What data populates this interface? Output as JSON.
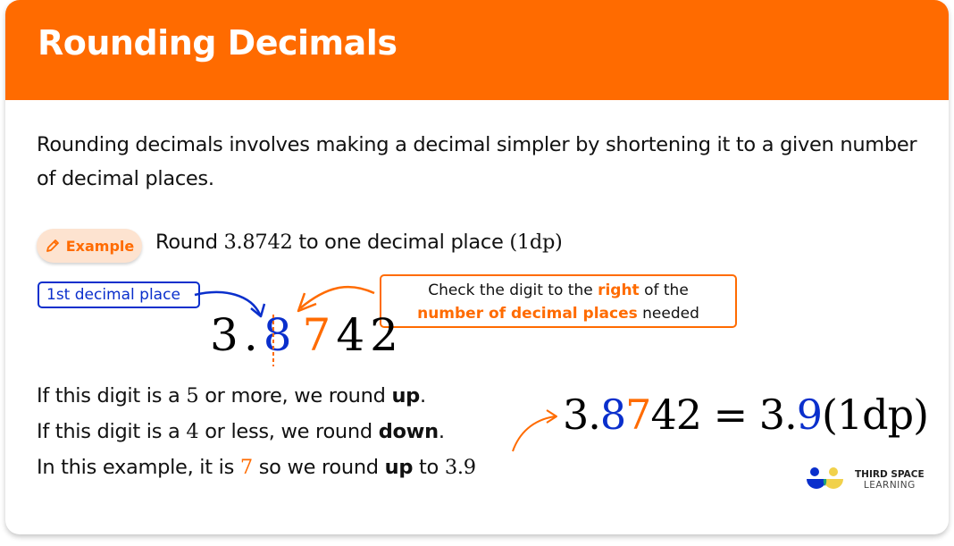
{
  "header": {
    "title": "Rounding Decimals",
    "background_color": "#ff6b00"
  },
  "intro": "Rounding decimals involves making a decimal simpler by shortening it to a given number of decimal places.",
  "example": {
    "badge_label": "Example",
    "badge_icon": "pencil-icon",
    "question_prefix": "Round ",
    "question_number": "3.8742",
    "question_suffix": " to one decimal place ",
    "question_dp": "(1dp)"
  },
  "annotations": {
    "first_decimal_label": "1st decimal place",
    "callout": {
      "part1": "Check the digit to the ",
      "emph1": "right",
      "part2": " of the",
      "emph2": "number of decimal places",
      "part3": " needed"
    }
  },
  "number_display": {
    "integer": "3",
    "point": ".",
    "first_decimal": "8",
    "check_digit": "7",
    "rest": "42"
  },
  "rules": [
    {
      "pre": "If this digit is a ",
      "num": "5",
      "mid": " or more, we round ",
      "bold": "up",
      "post": "."
    },
    {
      "pre": "If this digit is a ",
      "num": "4",
      "mid": " or less, we round ",
      "bold": "down",
      "post": "."
    },
    {
      "pre": "In this example, it is ",
      "num": "7",
      "mid": " so we round ",
      "bold": "up",
      "post": " to ",
      "result": "3.9"
    }
  ],
  "equation": {
    "lhs_int": "3.",
    "lhs_first": "8",
    "lhs_check": "7",
    "lhs_rest": "42",
    "equals": " = ",
    "rhs_int": "3.",
    "rhs_digit": "9",
    "rhs_suffix": "(1dp)"
  },
  "logo": {
    "line1": "THIRD SPACE",
    "line2": "LEARNING"
  },
  "colors": {
    "orange": "#ff6b00",
    "blue": "#0a2fcc",
    "badge_bg": "#fde3d0"
  }
}
